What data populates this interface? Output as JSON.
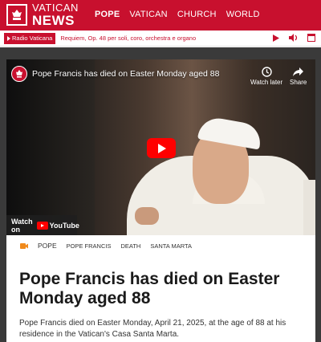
{
  "brand": {
    "line1": "VATICAN",
    "line2": "NEWS",
    "color": "#c8102e"
  },
  "nav": {
    "items": [
      {
        "label": "POPE",
        "active": true
      },
      {
        "label": "VATICAN",
        "active": false
      },
      {
        "label": "CHURCH",
        "active": false
      },
      {
        "label": "WORLD",
        "active": false
      }
    ]
  },
  "radio": {
    "station": "Radio Vaticana",
    "track": "Requiem, Op. 48 per soli, coro, orchestra e organo",
    "controls": [
      "play-icon",
      "volume-icon",
      "window-icon"
    ]
  },
  "video": {
    "title": "Pope Francis has died on Easter Monday aged 88",
    "watch_later": "Watch later",
    "share": "Share",
    "watch_on": "Watch on",
    "platform": "YouTube"
  },
  "article": {
    "tags": [
      "POPE",
      "POPE FRANCIS",
      "DEATH",
      "SANTA MARTA"
    ],
    "headline": "Pope Francis has died on Easter Monday aged 88",
    "summary": "Pope Francis died on Easter Monday, April 21, 2025, at the age of 88 at his residence in the Vatican's Casa Santa Marta."
  }
}
